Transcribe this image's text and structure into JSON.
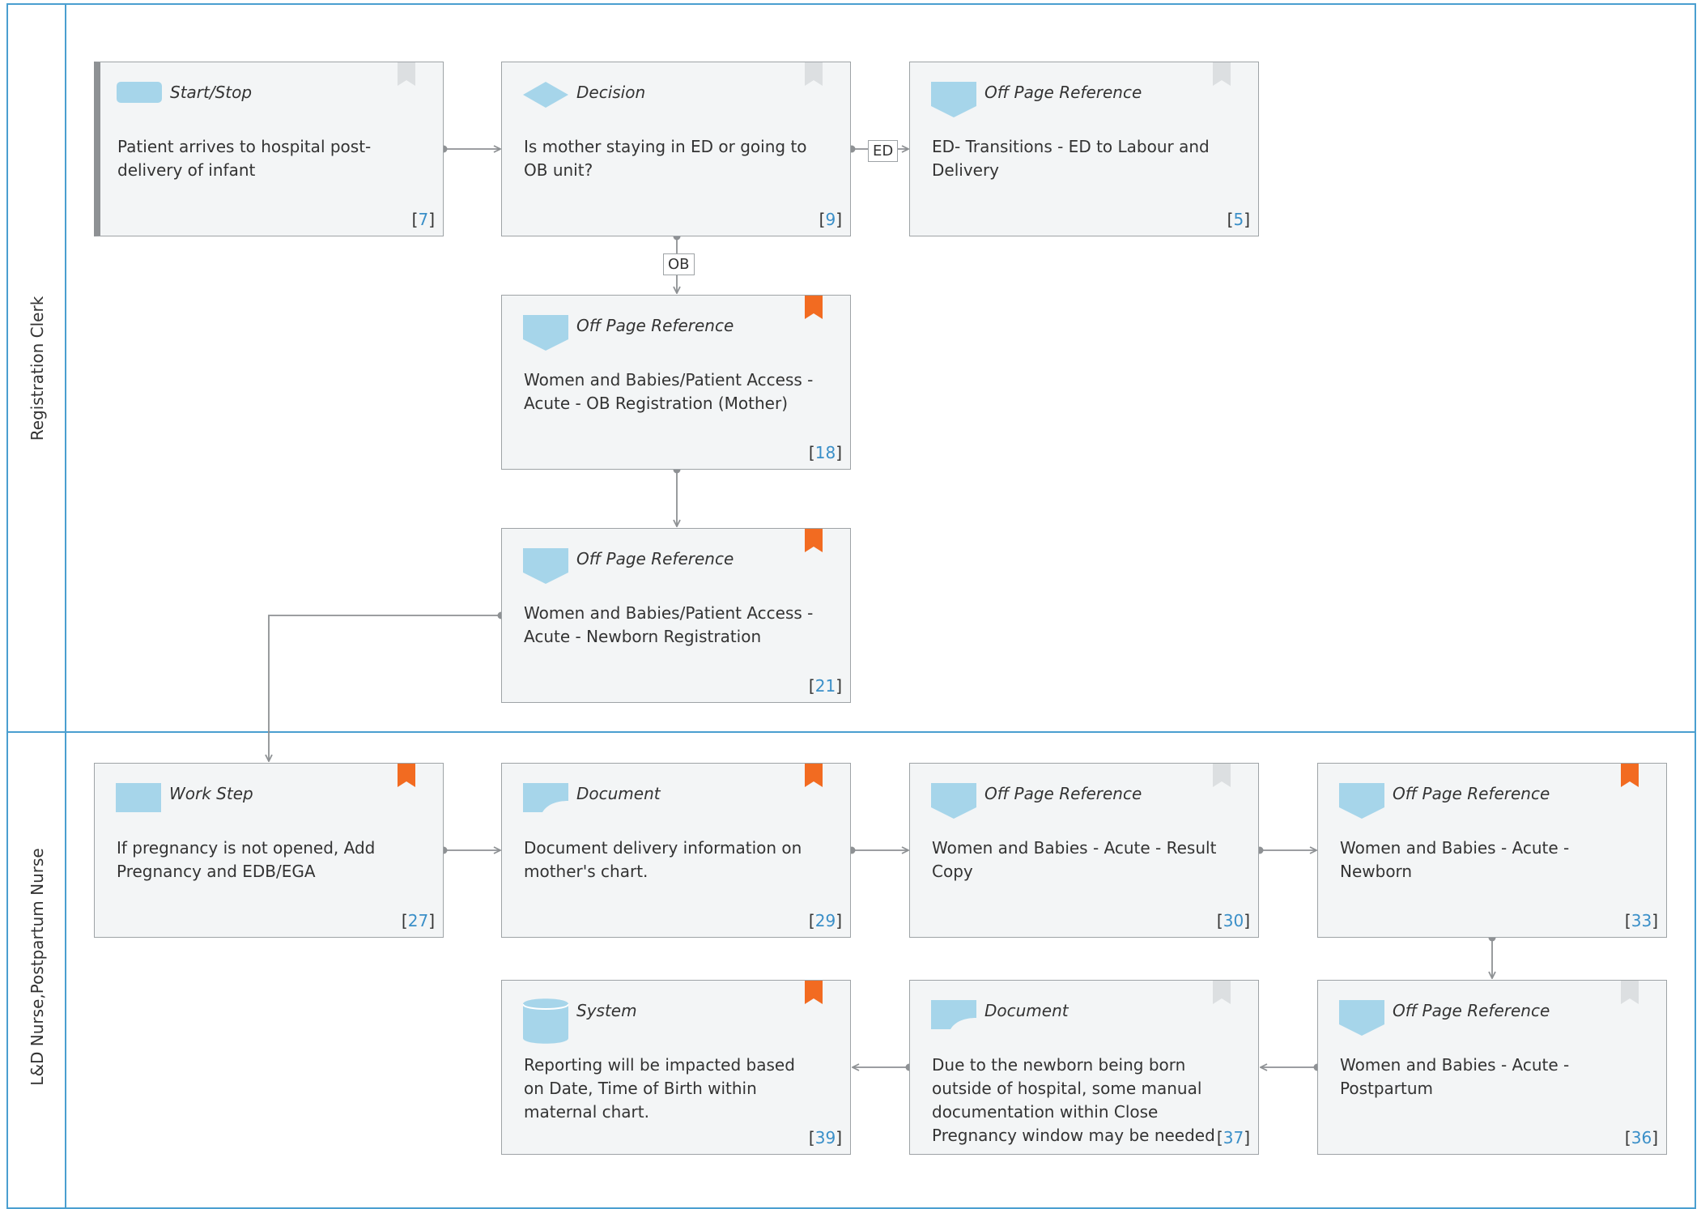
{
  "lanes": [
    {
      "label": "Registration Clerk"
    },
    {
      "label": "L&D Nurse,Postpartum Nurse"
    }
  ],
  "cards": [
    {
      "type": "Start/Stop",
      "text": "Patient arrives to hospital post-delivery of infant",
      "ref": "7",
      "bookmark": "inactive",
      "icon": "start-stop-icon"
    },
    {
      "type": "Decision",
      "text": "Is mother staying in ED or going to OB unit?",
      "ref": "9",
      "bookmark": "inactive",
      "icon": "decision-diamond-icon"
    },
    {
      "type": "Off Page Reference",
      "text": "ED- Transitions - ED to Labour and Delivery",
      "ref": "5",
      "bookmark": "inactive",
      "icon": "off-page-reference-icon"
    },
    {
      "type": "Off Page Reference",
      "text": "Women and Babies/Patient Access - Acute - OB Registration (Mother)",
      "ref": "18",
      "bookmark": "active",
      "icon": "off-page-reference-icon"
    },
    {
      "type": "Off Page Reference",
      "text": "Women and Babies/Patient Access - Acute - Newborn Registration",
      "ref": "21",
      "bookmark": "active",
      "icon": "off-page-reference-icon"
    },
    {
      "type": "Work Step",
      "text": "If pregnancy is not opened, Add Pregnancy and EDB/EGA",
      "ref": "27",
      "bookmark": "active",
      "icon": "work-step-icon"
    },
    {
      "type": "Document",
      "text": "Document delivery information on mother's chart.",
      "ref": "29",
      "bookmark": "active",
      "icon": "document-icon"
    },
    {
      "type": "Off Page Reference",
      "text": "Women and Babies - Acute - Result Copy",
      "ref": "30",
      "bookmark": "inactive",
      "icon": "off-page-reference-icon"
    },
    {
      "type": "Off Page Reference",
      "text": "Women and Babies - Acute - Newborn",
      "ref": "33",
      "bookmark": "active",
      "icon": "off-page-reference-icon"
    },
    {
      "type": "System",
      "text": "Reporting will be impacted based on Date, Time of Birth within maternal chart.",
      "ref": "39",
      "bookmark": "active",
      "icon": "system-database-icon"
    },
    {
      "type": "Document",
      "text": "Due to the newborn being born outside of hospital, some manual documentation within Close Pregnancy window may be needed",
      "ref": "37",
      "bookmark": "inactive",
      "icon": "document-icon"
    },
    {
      "type": "Off Page Reference",
      "text": "Women and Babies - Acute - Postpartum",
      "ref": "36",
      "bookmark": "inactive",
      "icon": "off-page-reference-icon"
    }
  ],
  "edge_labels": {
    "ed": "ED",
    "ob": "OB"
  },
  "colors": {
    "lane_border": "#4a9fd0",
    "icon_fill": "#a6d5ea",
    "bookmark_active": "#f26b21",
    "bookmark_inactive": "#dcdfe1",
    "ref_number": "#3a8fc8",
    "connector": "#8e9194"
  }
}
